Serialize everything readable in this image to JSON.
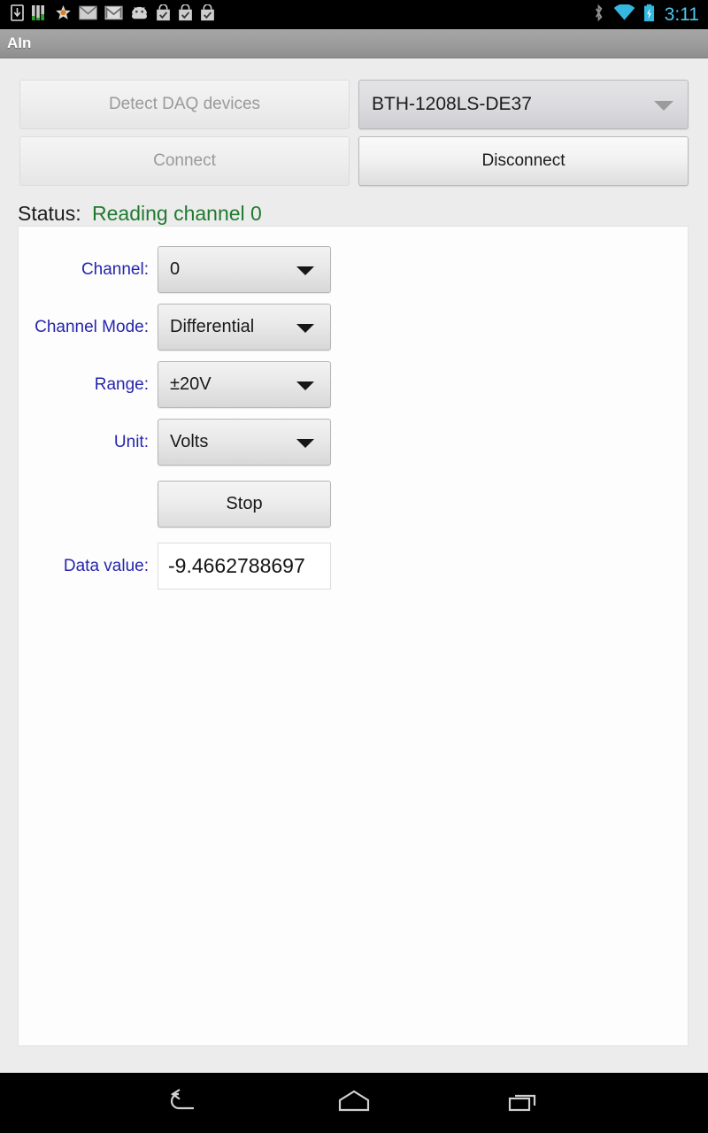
{
  "statusbar": {
    "icons_left": [
      "download-icon",
      "equalizer-icon",
      "star-icon",
      "email-icon",
      "gmail-icon",
      "android-icon",
      "play-store-bag-icon",
      "play-store-bag-icon",
      "play-store-bag-icon"
    ],
    "icons_right": [
      "bluetooth-icon",
      "wifi-icon",
      "battery-charging-icon"
    ],
    "clock": "3:11",
    "accent_color": "#4ec8ee"
  },
  "titlebar": {
    "title": "AIn"
  },
  "top_controls": {
    "detect_button": {
      "label": "Detect DAQ devices",
      "enabled": false
    },
    "device_spinner": {
      "value": "BTH-1208LS-DE37",
      "enabled": true,
      "caret": "chevron-down-icon"
    },
    "connect_button": {
      "label": "Connect",
      "enabled": false
    },
    "disconnect_button": {
      "label": "Disconnect",
      "enabled": true
    }
  },
  "status": {
    "label": "Status:",
    "value": "Reading channel 0",
    "value_color": "#1f7a2e"
  },
  "form": {
    "label_color": "#2525ad",
    "rows": [
      {
        "label": "Channel:",
        "value": "0"
      },
      {
        "label": "Channel Mode:",
        "value": "Differential"
      },
      {
        "label": "Range:",
        "value": "±20V"
      },
      {
        "label": "Unit:",
        "value": "Volts"
      }
    ],
    "stop_button": {
      "label": "Stop"
    },
    "data_value": {
      "label": "Data value:",
      "value": "-9.4662788697"
    }
  },
  "navbar": {
    "back": "back-icon",
    "home": "home-icon",
    "recents": "recents-icon"
  }
}
